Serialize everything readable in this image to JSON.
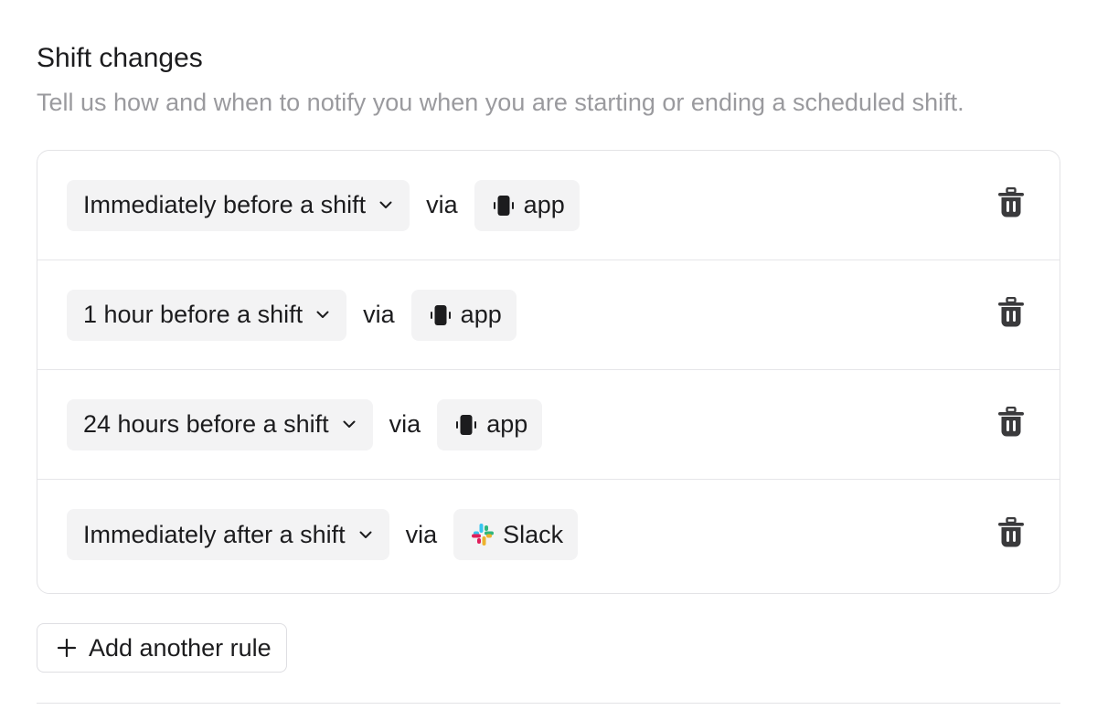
{
  "section": {
    "title": "Shift changes",
    "subtitle": "Tell us how and when to notify you when you are starting or ending a scheduled shift."
  },
  "rules": [
    {
      "timing": "Immediately before a shift",
      "via": "via",
      "channel": "app",
      "channel_icon": "mobile-app-icon"
    },
    {
      "timing": "1 hour before a shift",
      "via": "via",
      "channel": "app",
      "channel_icon": "mobile-app-icon"
    },
    {
      "timing": "24 hours before a shift",
      "via": "via",
      "channel": "app",
      "channel_icon": "mobile-app-icon"
    },
    {
      "timing": "Immediately after a shift",
      "via": "via",
      "channel": "Slack",
      "channel_icon": "slack-icon"
    }
  ],
  "add_rule": {
    "label": "Add another rule",
    "icon": "plus-icon"
  },
  "icons": {
    "dropdown": "chevron-down-icon",
    "delete": "trash-icon"
  },
  "colors": {
    "text": "#1c1c1e",
    "muted_text": "#9a9a9e",
    "pill_background": "#f3f3f4",
    "border": "#e3e3e6",
    "slack_blue": "#36c5f0",
    "slack_green": "#2eb67d",
    "slack_red": "#e01e5a",
    "slack_yellow": "#ecb22e"
  }
}
